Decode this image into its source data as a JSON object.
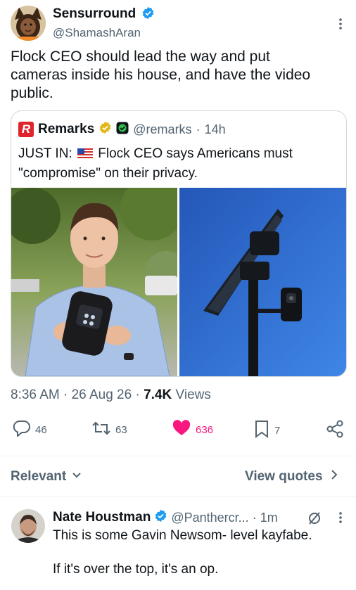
{
  "main_tweet": {
    "author_name": "Sensurround",
    "author_handle": "@ShamashAran",
    "text_lines": [
      "Flock CEO should lead the way and put",
      "cameras inside his house, and have the video",
      "public."
    ],
    "timestamp_time": "8:36 AM",
    "timestamp_date": "26 Aug 26",
    "views_count": "7.4K",
    "views_label": "Views"
  },
  "quoted_tweet": {
    "logo_letter": "R",
    "author_name": "Remarks",
    "author_handle": "@remarks",
    "age": "14h",
    "prefix": "JUST IN:",
    "text_line1": "Flock CEO says Americans must",
    "text_line2": "\"compromise\" on their privacy."
  },
  "actions": {
    "replies": "46",
    "retweets": "63",
    "likes": "636",
    "bookmarks": "7"
  },
  "sort": {
    "label": "Relevant",
    "view_quotes": "View quotes"
  },
  "reply": {
    "author_name": "Nate Houstman",
    "author_handle": "@Panthercr...",
    "age": "1m",
    "text_line1": "This is some Gavin Newsom- level kayfabe.",
    "text_line2": "If it's over the top, it's an op."
  },
  "colors": {
    "verified_blue": "#1d9bf0",
    "like_pink": "#f91880",
    "gold_badge": "#e2b719",
    "remarks_red": "#e0242b"
  }
}
